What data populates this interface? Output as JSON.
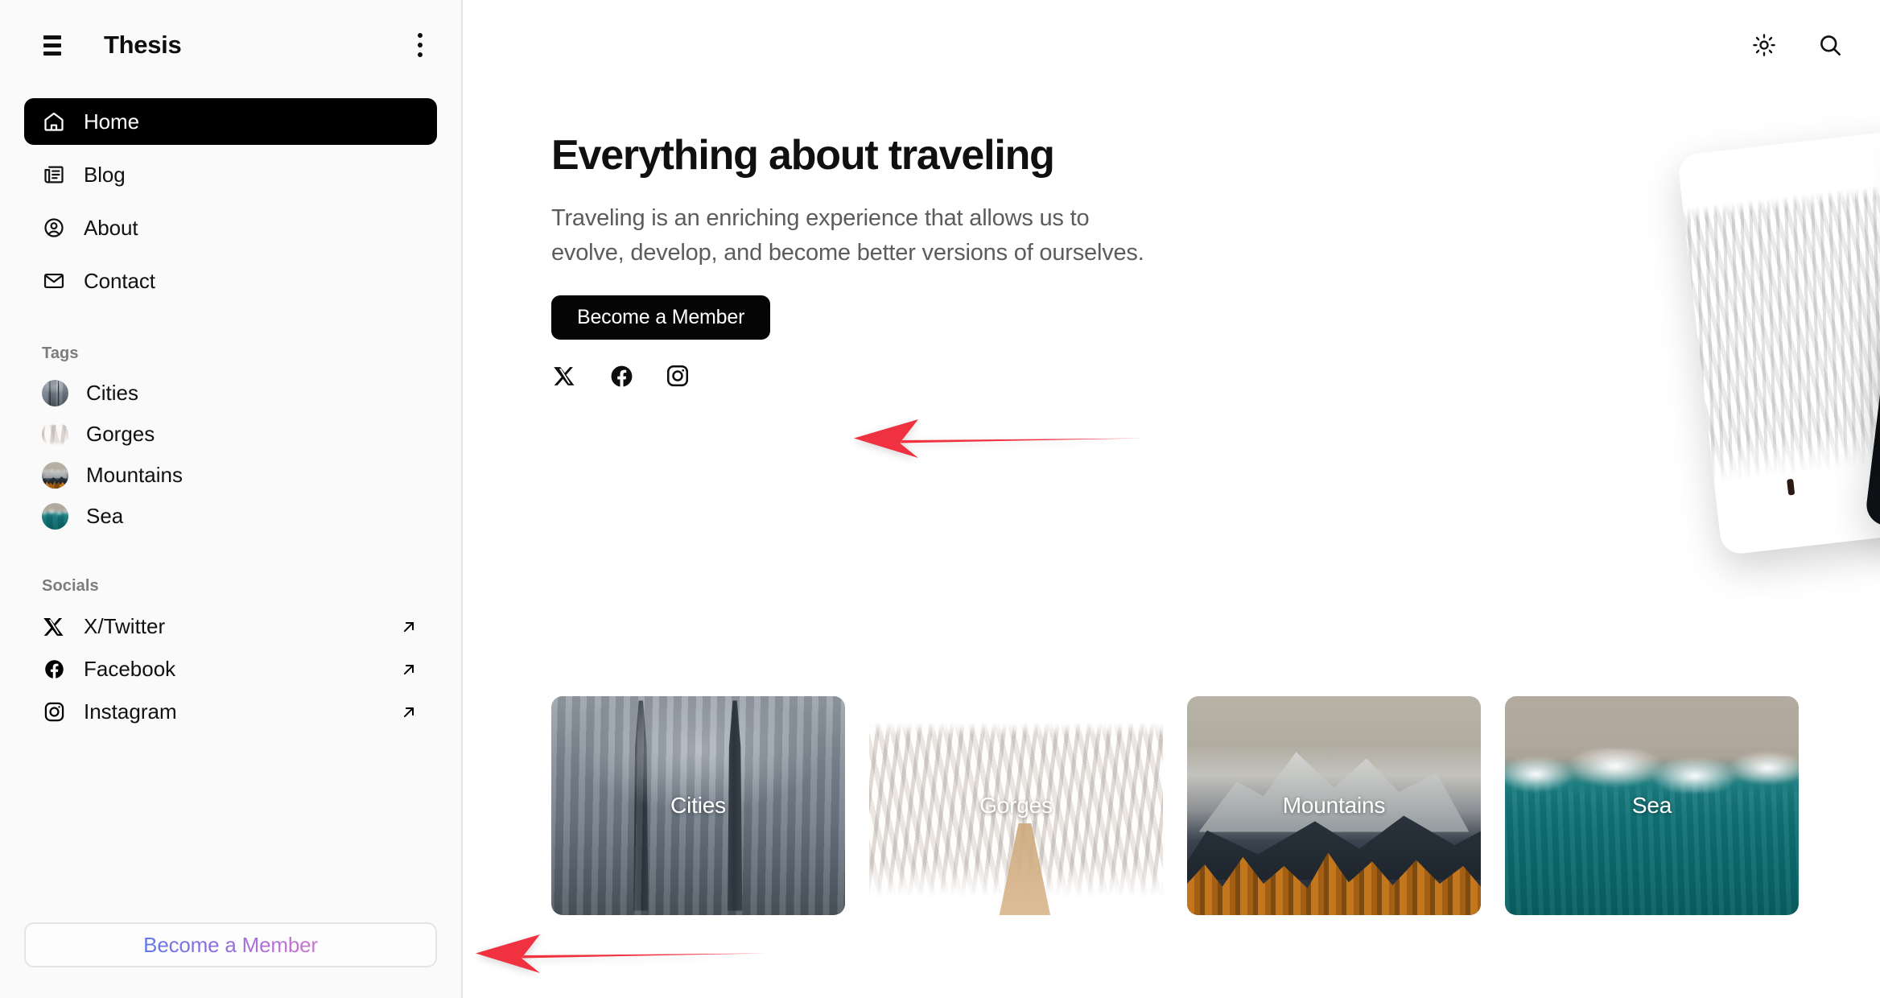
{
  "sidebar": {
    "menu_icon": "hamburger-icon",
    "brand": "Thesis",
    "more_icon": "kebab-menu-icon",
    "nav": [
      {
        "label": "Home",
        "icon": "home-icon",
        "active": true
      },
      {
        "label": "Blog",
        "icon": "newspaper-icon",
        "active": false
      },
      {
        "label": "About",
        "icon": "user-circle-icon",
        "active": false
      },
      {
        "label": "Contact",
        "icon": "envelope-icon",
        "active": false
      }
    ],
    "tags_heading": "Tags",
    "tags": [
      {
        "label": "Cities",
        "thumb": "cities-thumb"
      },
      {
        "label": "Gorges",
        "thumb": "gorges-thumb"
      },
      {
        "label": "Mountains",
        "thumb": "mountains-thumb"
      },
      {
        "label": "Sea",
        "thumb": "sea-thumb"
      }
    ],
    "socials_heading": "Socials",
    "socials": [
      {
        "label": "X/Twitter",
        "icon": "x-twitter-icon",
        "external_icon": "arrow-up-right-icon"
      },
      {
        "label": "Facebook",
        "icon": "facebook-icon",
        "external_icon": "arrow-up-right-icon"
      },
      {
        "label": "Instagram",
        "icon": "instagram-icon",
        "external_icon": "arrow-up-right-icon"
      }
    ],
    "member_button": "Become a Member",
    "member_gradient_from": "#6478e8",
    "member_gradient_to": "#c977cf"
  },
  "topbar": {
    "theme_toggle_icon": "sun-icon",
    "search_icon": "search-icon"
  },
  "hero": {
    "title": "Everything about traveling",
    "body": "Traveling is an enriching experience that allows us to evolve, develop, and become better versions of ourselves.",
    "cta_label": "Become a Member",
    "cta_bg": "#050505",
    "socials": [
      {
        "icon": "x-twitter-icon"
      },
      {
        "icon": "facebook-icon"
      },
      {
        "icon": "instagram-icon"
      }
    ],
    "photos": [
      {
        "name": "canyon-photo"
      },
      {
        "name": "portrait-photo"
      }
    ]
  },
  "categories": [
    {
      "label": "Cities",
      "media": "cities-photo"
    },
    {
      "label": "Gorges",
      "media": "gorges-photo"
    },
    {
      "label": "Mountains",
      "media": "mountains-photo"
    },
    {
      "label": "Sea",
      "media": "sea-photo"
    }
  ],
  "annotations": {
    "color": "#f0313f",
    "arrows": [
      {
        "name": "arrow-to-hero-cta",
        "points_to": "Become a Member (hero)"
      },
      {
        "name": "arrow-to-sidebar-cta",
        "points_to": "Become a Member (sidebar)"
      }
    ]
  }
}
